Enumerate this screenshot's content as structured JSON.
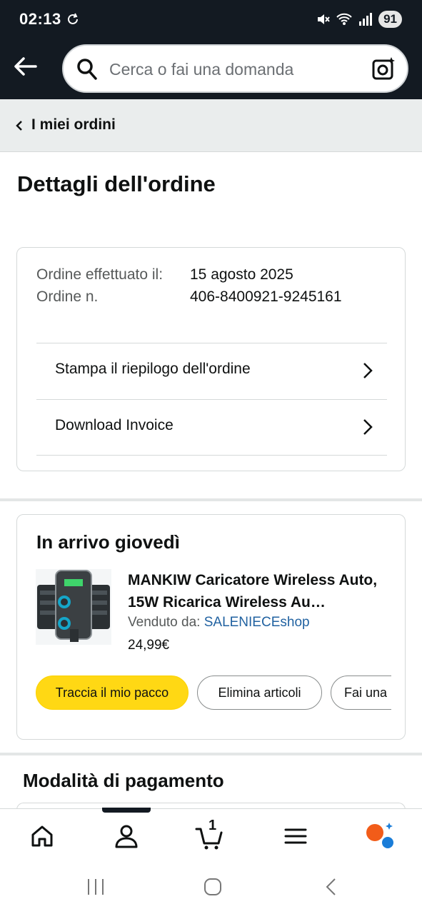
{
  "status_bar": {
    "time": "02:13",
    "battery": "91"
  },
  "search": {
    "placeholder": "Cerca o fai una domanda"
  },
  "breadcrumb": {
    "label": "I miei ordini"
  },
  "page": {
    "title": "Dettagli dell'ordine"
  },
  "order": {
    "placed_label": "Ordine effettuato il:",
    "number_label": "Ordine n.",
    "placed_value": "15 agosto 2025",
    "number_value": "406-8400921-9245161",
    "actions": [
      {
        "label": "Stampa il riepilogo dell'ordine"
      },
      {
        "label": "Download Invoice"
      }
    ]
  },
  "shipment": {
    "title": "In arrivo giovedì",
    "product_title": "MANKIW Caricatore Wireless Auto, 15W Ricarica Wireless Au…",
    "sold_by_label": "Venduto da:",
    "seller": "SALENIECEshop",
    "price": "24,99€",
    "buttons": {
      "track": "Traccia il mio pacco",
      "delete": "Elimina articoli",
      "ask": "Fai una"
    }
  },
  "payment": {
    "title": "Modalità di pagamento"
  },
  "bottom_nav": {
    "items": [
      "home-icon",
      "account-icon",
      "cart-icon",
      "menu-icon",
      "rufus-icon"
    ],
    "cart_count": "1"
  },
  "colors": {
    "header": "#131a22",
    "primary_button": "#ffd814",
    "link": "#2162a1"
  }
}
